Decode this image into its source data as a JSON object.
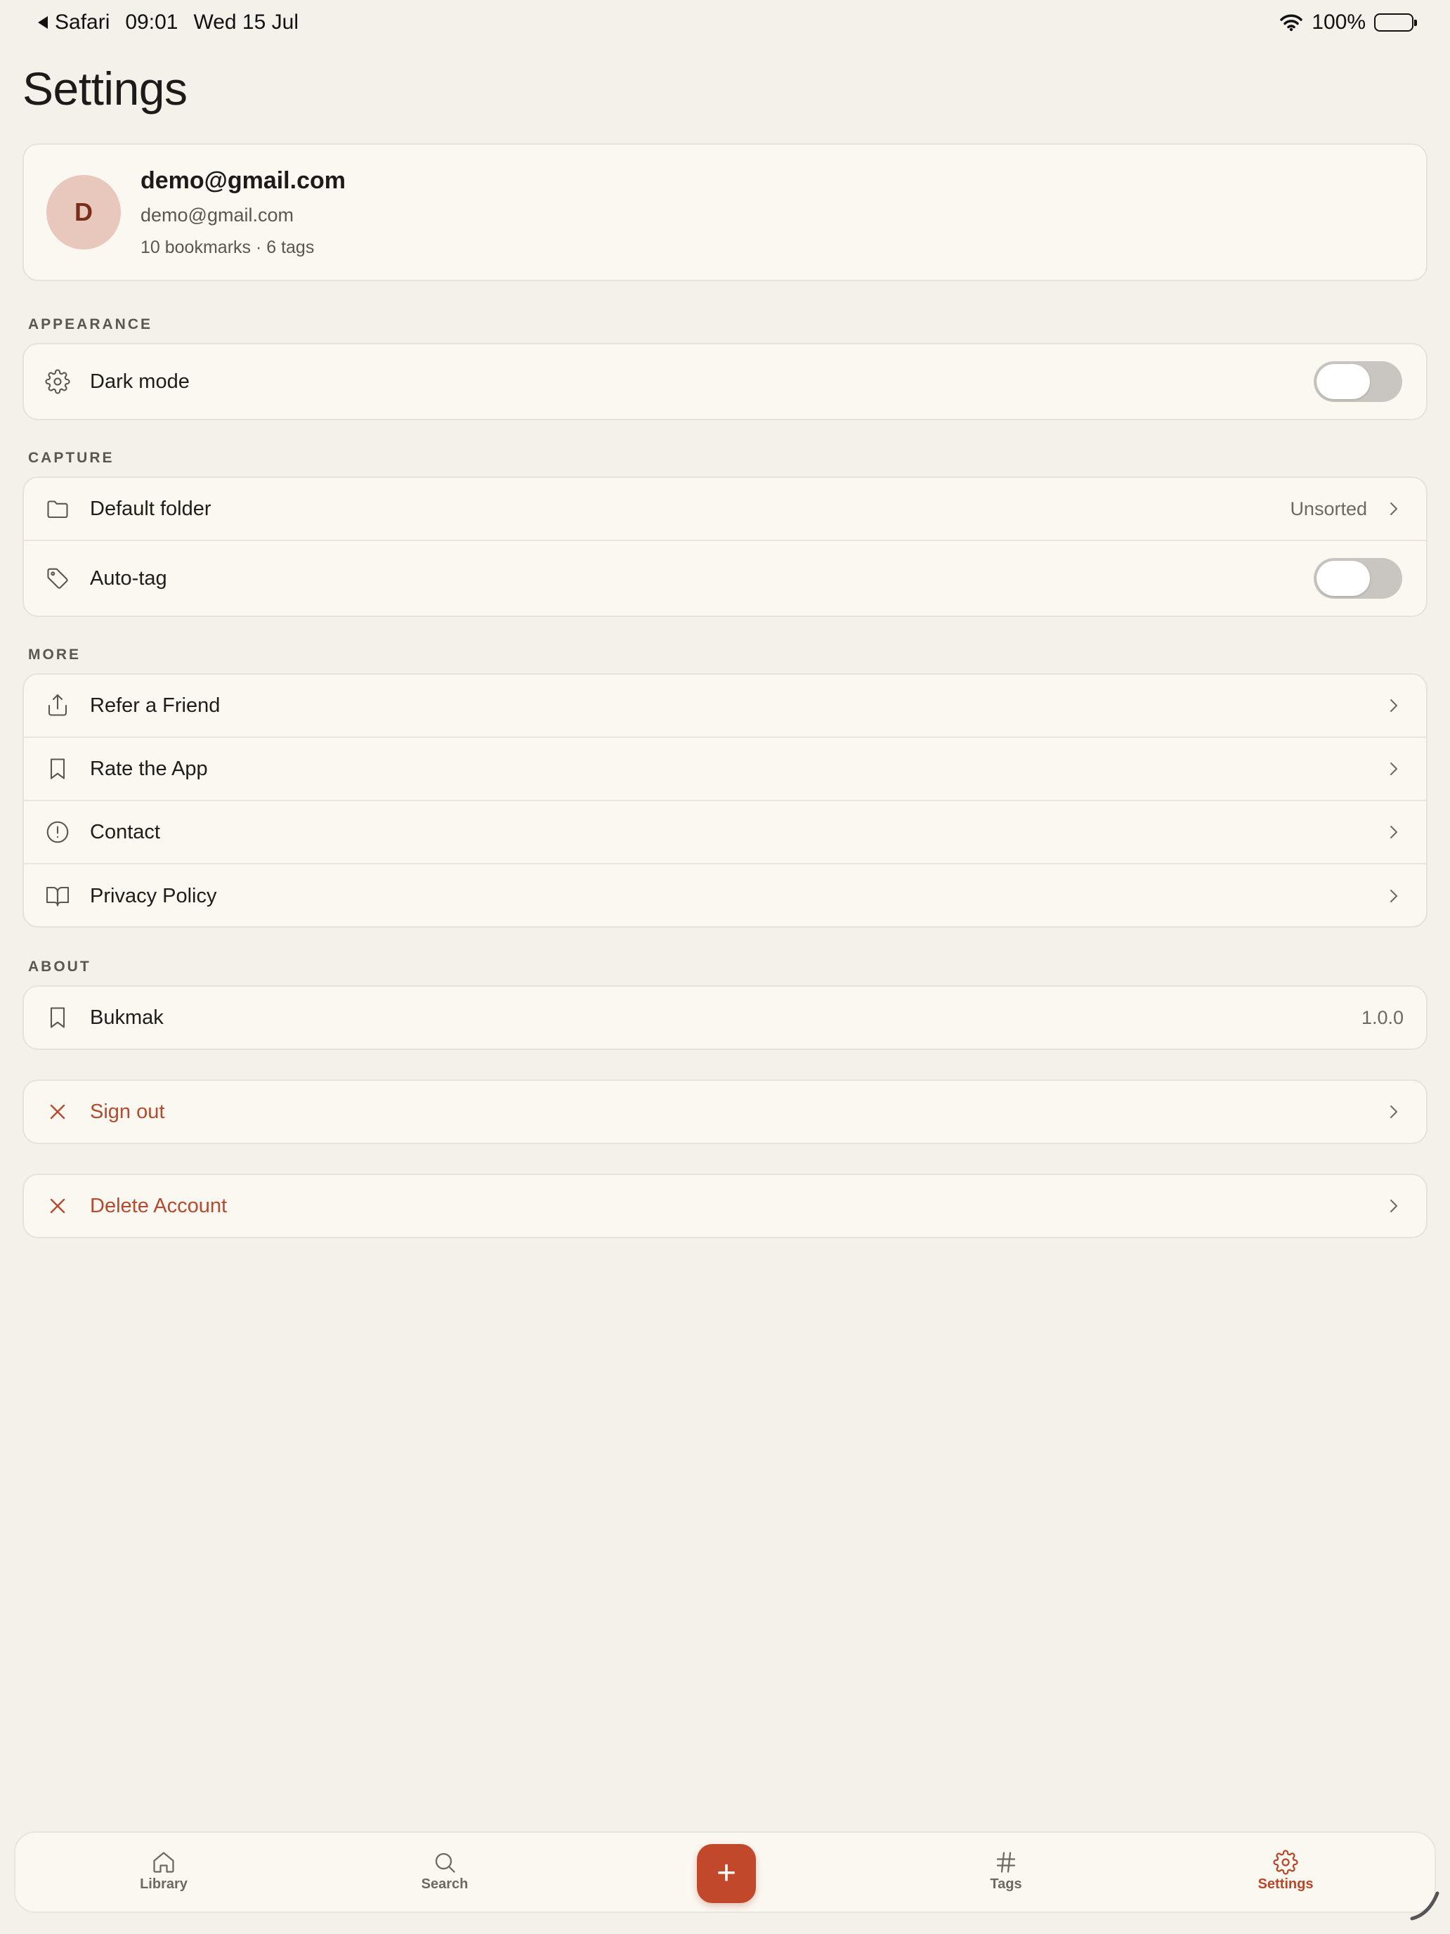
{
  "status_bar": {
    "back_app": "Safari",
    "time": "09:01",
    "date": "Wed 15 Jul",
    "battery": "100%"
  },
  "title": "Settings",
  "profile": {
    "avatar_letter": "D",
    "name": "demo@gmail.com",
    "email": "demo@gmail.com",
    "stats": "10 bookmarks · 6 tags"
  },
  "appearance": {
    "header": "APPEARANCE",
    "dark_mode_label": "Dark mode",
    "dark_mode_on": false
  },
  "capture": {
    "header": "CAPTURE",
    "default_folder_label": "Default folder",
    "default_folder_value": "Unsorted",
    "auto_tag_label": "Auto-tag",
    "auto_tag_on": false
  },
  "more": {
    "header": "MORE",
    "items": [
      {
        "label": "Refer a Friend",
        "icon": "share-icon"
      },
      {
        "label": "Rate the App",
        "icon": "bookmark-icon"
      },
      {
        "label": "Contact",
        "icon": "alert-circle-icon"
      },
      {
        "label": "Privacy Policy",
        "icon": "book-open-icon"
      }
    ]
  },
  "about": {
    "header": "ABOUT",
    "app_name": "Bukmak",
    "version": "1.0.0"
  },
  "actions": {
    "sign_out": "Sign out",
    "delete_account": "Delete Account"
  },
  "tabs": [
    {
      "label": "Library",
      "icon": "home-icon"
    },
    {
      "label": "Search",
      "icon": "search-icon"
    },
    {
      "label": "Tags",
      "icon": "hash-icon"
    },
    {
      "label": "Settings",
      "icon": "gear-icon",
      "active": true
    }
  ],
  "fab_label": "+",
  "colors": {
    "accent": "#c2482c",
    "danger_text": "#b54a2e",
    "background": "#f4f0ea",
    "card": "#fbf8f2"
  }
}
